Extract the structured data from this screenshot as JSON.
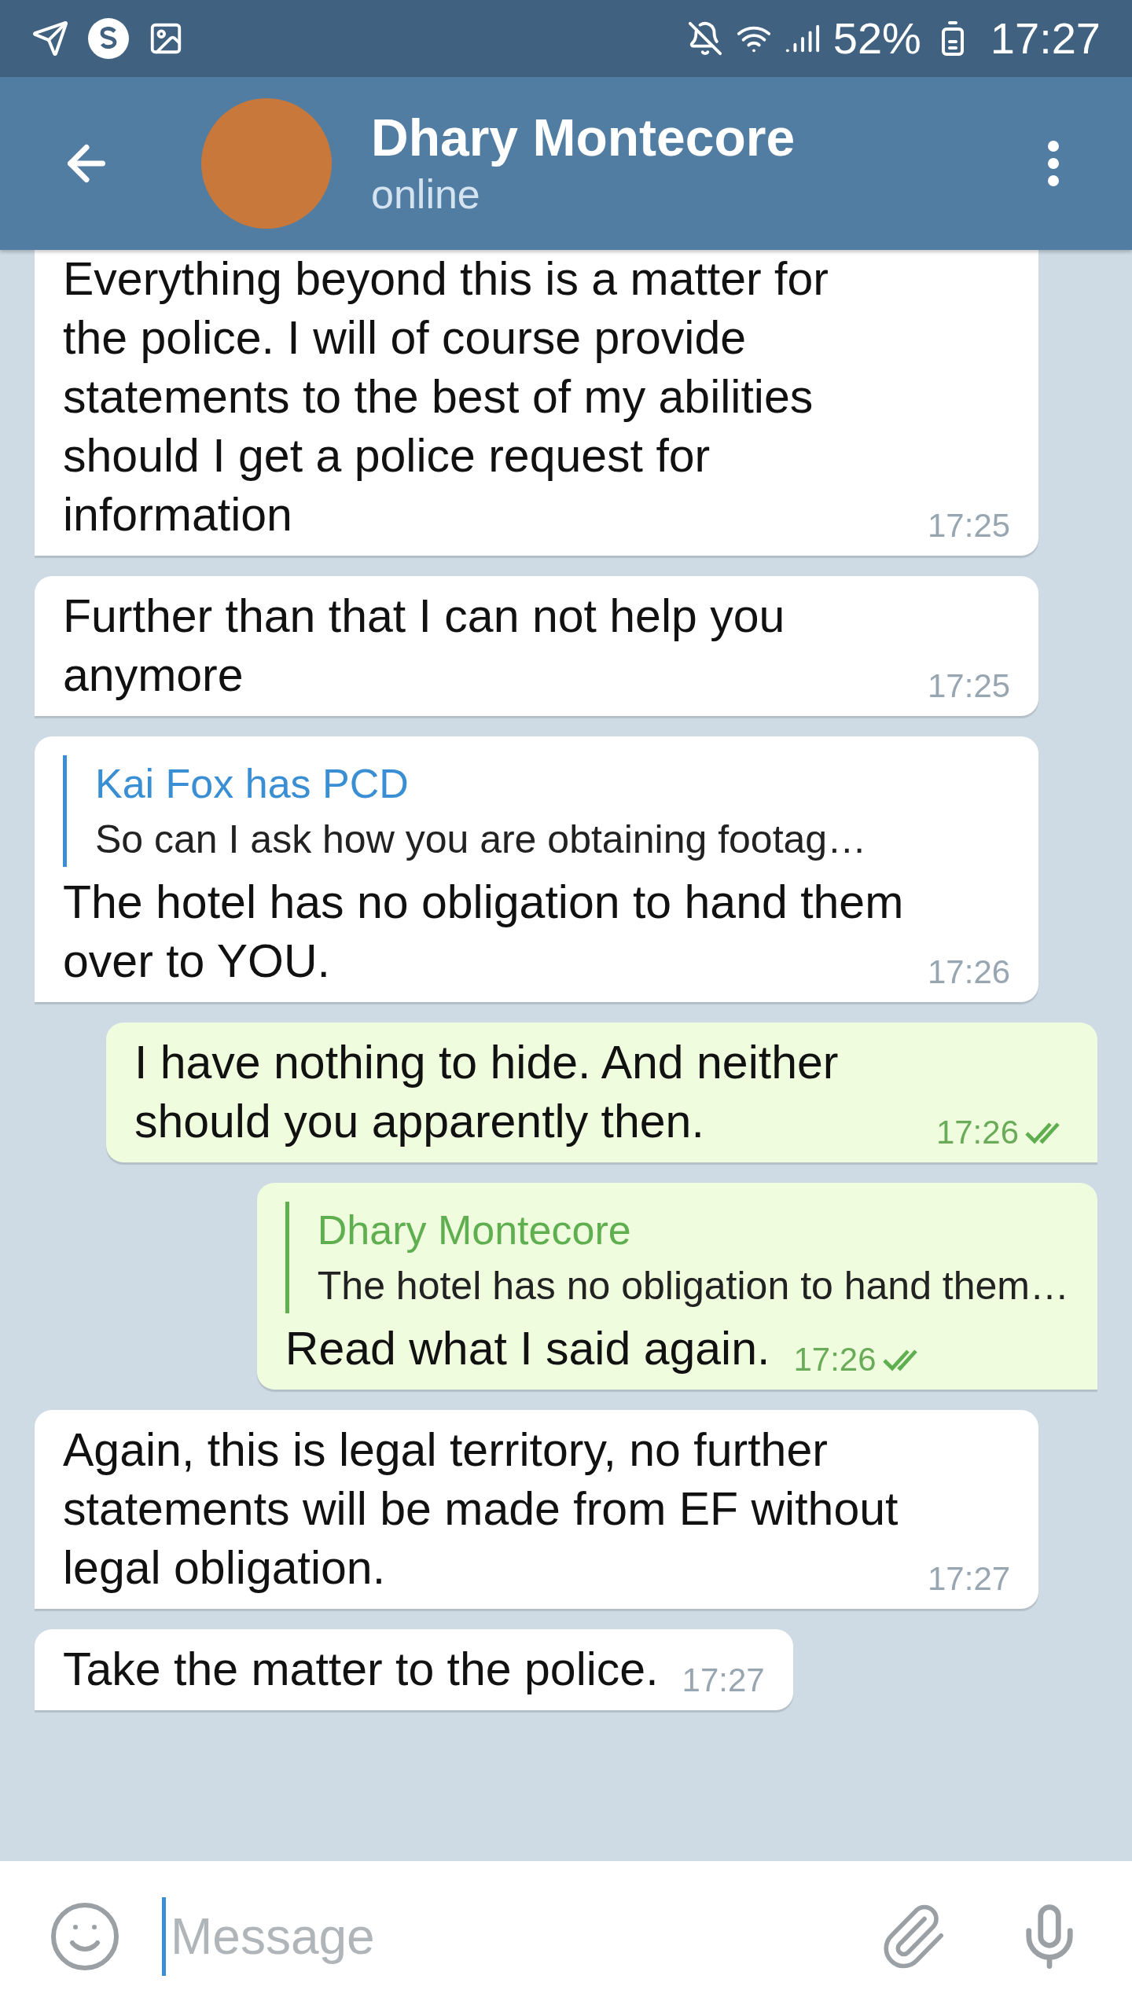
{
  "status_bar": {
    "battery": "52%",
    "time": "17:27"
  },
  "header": {
    "name": "Dhary Montecore",
    "status": "online"
  },
  "messages": [
    {
      "kind": "incoming",
      "text": "Everything beyond this is a matter for the police. I will of course provide statements to the best of my abilities should I get a police request for information",
      "time": "17:25"
    },
    {
      "kind": "incoming",
      "text": "Further than that I can not help you anymore",
      "time": "17:25"
    },
    {
      "kind": "incoming",
      "reply": {
        "name": "Kai Fox has PCD",
        "text": "So can I ask how you are obtaining footag…"
      },
      "text": "The hotel has no obligation to hand them over to YOU.",
      "time": "17:26"
    },
    {
      "kind": "outgoing",
      "text": "I have nothing to hide. And neither should you apparently then.",
      "time": "17:26",
      "read": true
    },
    {
      "kind": "outgoing",
      "reply": {
        "name": "Dhary Montecore",
        "text": "The hotel has no obligation to hand them…"
      },
      "text": "Read what I said again.",
      "time": "17:26",
      "read": true
    },
    {
      "kind": "incoming",
      "text": "Again, this is legal territory, no further statements will be made from EF without legal obligation.",
      "time": "17:27"
    },
    {
      "kind": "incoming",
      "text": "Take the matter to the police.",
      "time": "17:27"
    }
  ],
  "composer": {
    "placeholder": "Message"
  }
}
